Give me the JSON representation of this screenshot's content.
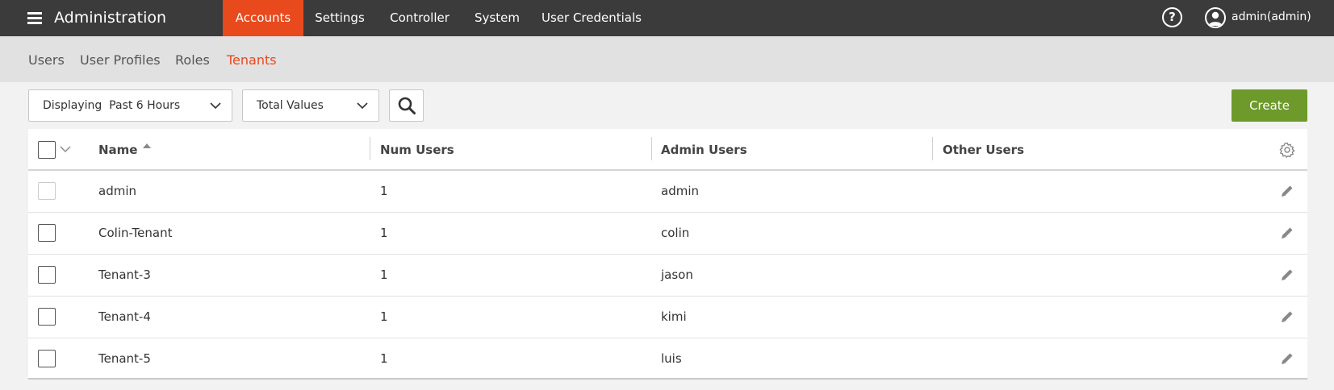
{
  "header": {
    "title": "Administration",
    "nav": [
      {
        "label": "Accounts",
        "active": true
      },
      {
        "label": "Settings",
        "active": false
      },
      {
        "label": "Controller",
        "active": false
      },
      {
        "label": "System",
        "active": false
      },
      {
        "label": "User Credentials",
        "active": false
      }
    ],
    "help_label": "?",
    "user_label": "admin(admin)"
  },
  "subnav": {
    "tabs": [
      {
        "label": "Users",
        "active": false
      },
      {
        "label": "User Profiles",
        "active": false
      },
      {
        "label": "Roles",
        "active": false
      },
      {
        "label": "Tenants",
        "active": true
      }
    ]
  },
  "toolbar": {
    "time_range": {
      "prefix": "Displaying",
      "value": "Past 6 Hours"
    },
    "value_mode": "Total Values",
    "create_label": "Create"
  },
  "table": {
    "columns": [
      "Name",
      "Num Users",
      "Admin Users",
      "Other Users"
    ],
    "sort": {
      "column": "Name",
      "direction": "ascending"
    },
    "rows": [
      {
        "name": "admin",
        "num_users": "1",
        "admin_users": "admin",
        "other_users": "",
        "selectable": false
      },
      {
        "name": "Colin-Tenant",
        "num_users": "1",
        "admin_users": "colin",
        "other_users": "",
        "selectable": true
      },
      {
        "name": "Tenant-3",
        "num_users": "1",
        "admin_users": "jason",
        "other_users": "",
        "selectable": true
      },
      {
        "name": "Tenant-4",
        "num_users": "1",
        "admin_users": "kimi",
        "other_users": "",
        "selectable": true
      },
      {
        "name": "Tenant-5",
        "num_users": "1",
        "admin_users": "luis",
        "other_users": "",
        "selectable": true
      }
    ]
  },
  "colors": {
    "topbar": "#3b3b3b",
    "accent": "#e8491d",
    "create_button": "#6d9a2a",
    "subnav": "#e1e1e1"
  }
}
